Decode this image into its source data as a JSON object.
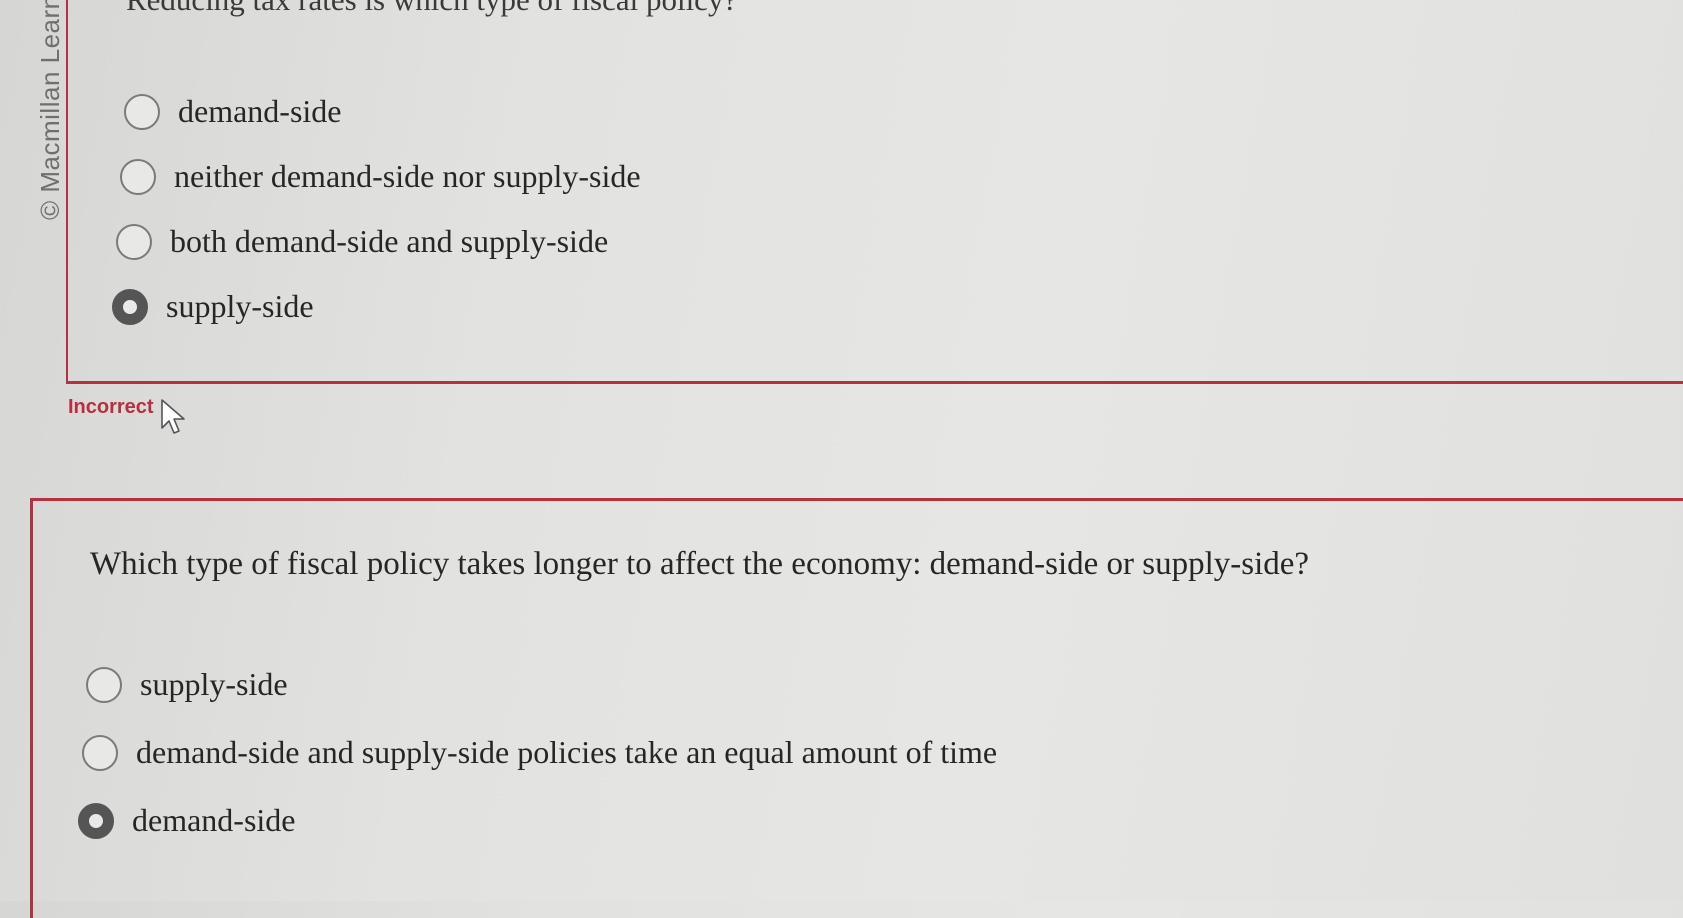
{
  "watermark": "© Macmillan Learn",
  "question1": {
    "text": "Reducing tax rates is which type of fiscal policy?",
    "options": [
      {
        "label": "demand-side",
        "selected": false
      },
      {
        "label": "neither demand-side nor supply-side",
        "selected": false
      },
      {
        "label": "both demand-side and supply-side",
        "selected": false
      },
      {
        "label": "supply-side",
        "selected": true
      }
    ],
    "feedback": "Incorrect"
  },
  "question2": {
    "text": "Which type of fiscal policy takes longer to affect the economy: demand-side or supply-side?",
    "options": [
      {
        "label": "supply-side",
        "selected": false
      },
      {
        "label": "demand-side and supply-side policies take an equal amount of time",
        "selected": false
      },
      {
        "label": "demand-side",
        "selected": true
      }
    ]
  },
  "colors": {
    "accent": "#b53040",
    "radio_selected": "#555555"
  },
  "icons": {
    "cursor": "mouse-pointer-icon"
  }
}
